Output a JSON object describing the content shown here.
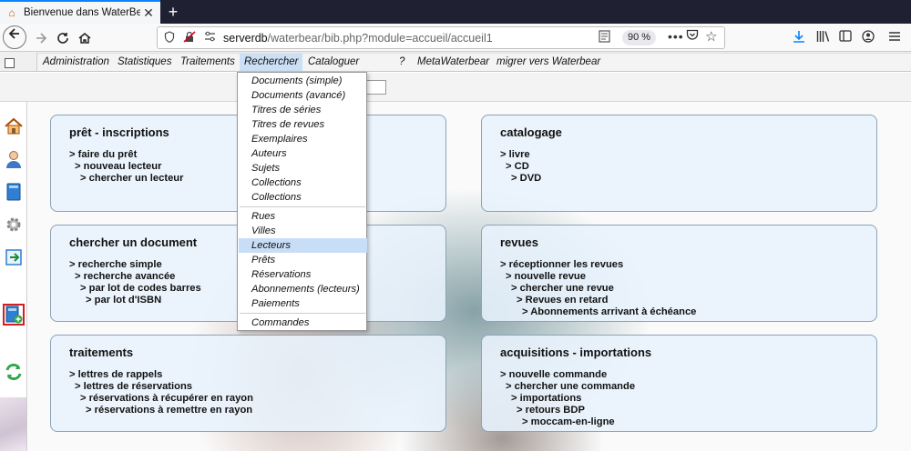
{
  "browser": {
    "tab_title": "Bienvenue dans WaterBear",
    "close_glyph": "✕",
    "newtab_glyph": "+",
    "url_host": "serverdb",
    "url_path": "/waterbear/bib.php?module=accueil/accueil1",
    "zoom": "90 %"
  },
  "menu": {
    "items": [
      "Administration",
      "Statistiques",
      "Traitements",
      "Rechercher",
      "Cataloguer",
      "?",
      "MetaWaterbear",
      "migrer vers Waterbear"
    ],
    "active": "Rechercher"
  },
  "dropdown": {
    "group1": [
      "Documents (simple)",
      "Documents (avancé)",
      "Titres de séries",
      "Titres de revues",
      "Exemplaires",
      "Auteurs",
      "Sujets",
      "Collections",
      "Collections"
    ],
    "group2": [
      "Rues",
      "Villes",
      "Lecteurs",
      "Prêts",
      "Réservations",
      "Abonnements (lecteurs)",
      "Paiements"
    ],
    "group3": [
      "Commandes"
    ],
    "highlighted": "Lecteurs"
  },
  "panels": {
    "pret": {
      "title": "prêt - inscriptions",
      "links": [
        "> faire du prêt",
        "> nouveau lecteur",
        "> chercher un lecteur"
      ]
    },
    "catalogage": {
      "title": "catalogage",
      "links": [
        "> livre",
        "> CD",
        "> DVD"
      ]
    },
    "chercher": {
      "title": "chercher un document",
      "links": [
        "> recherche simple",
        "> recherche avancée",
        "> par lot de codes barres",
        "> par lot d'ISBN"
      ]
    },
    "revues": {
      "title": "revues",
      "links": [
        "> réceptionner les revues",
        "> nouvelle revue",
        "> chercher une revue",
        "> Revues en retard",
        "> Abonnements arrivant à échéance"
      ]
    },
    "traitements": {
      "title": "traitements",
      "links": [
        "> lettres de rappels",
        "> lettres de réservations",
        "> réservations à récupérer en rayon",
        "> réservations à remettre en rayon"
      ]
    },
    "acquisitions": {
      "title": "acquisitions - importations",
      "links": [
        "> nouvelle commande",
        "> chercher une commande",
        "> importations",
        "> retours BDP",
        "> moccam-en-ligne"
      ]
    }
  }
}
